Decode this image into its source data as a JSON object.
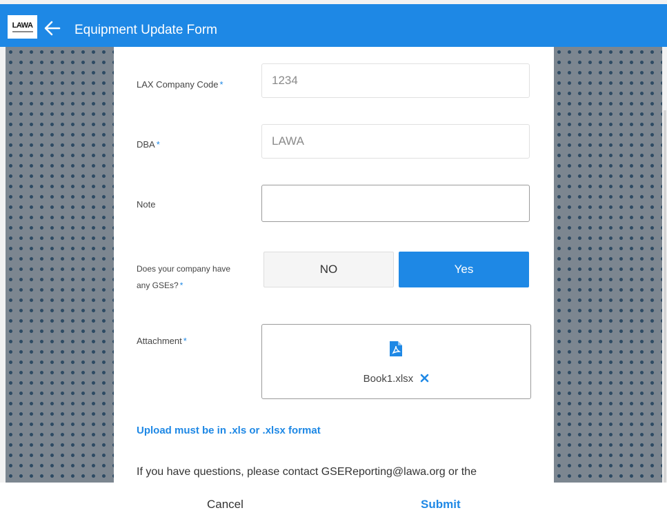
{
  "header": {
    "logo_text": "LAWA",
    "title": "Equipment Update Form",
    "background_color": "#1e88e5"
  },
  "form": {
    "company_code": {
      "label": "LAX Company Code",
      "required_mark": "*",
      "value": "1234"
    },
    "dba": {
      "label": "DBA",
      "required_mark": "*",
      "value": "LAWA"
    },
    "note": {
      "label": "Note",
      "value": ""
    },
    "gse_question": {
      "label_line1": "Does your company have",
      "label_line2": "any GSEs?",
      "required_mark": "*",
      "options": [
        "NO",
        "Yes"
      ],
      "selected": "Yes"
    },
    "attachment": {
      "label": "Attachment",
      "required_mark": "*",
      "file_icon": "pdf-file-icon",
      "file_name": "Book1.xlsx",
      "remove_icon": "close-icon"
    },
    "upload_note": "Upload must be in .xls or .xlsx format",
    "contact_text": "If you have questions, please contact GSEReporting@lawa.org or the"
  },
  "footer": {
    "cancel_label": "Cancel",
    "submit_label": "Submit"
  },
  "colors": {
    "accent": "#1e88e5",
    "pattern_bg": "#7c8690",
    "pattern_dot": "#2d4a63"
  }
}
